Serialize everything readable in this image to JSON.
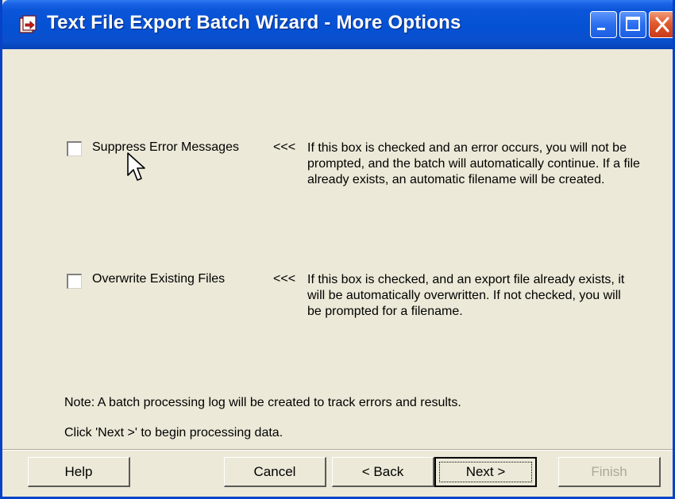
{
  "window": {
    "title": "Text File Export Batch Wizard - More Options"
  },
  "options": [
    {
      "label": "Suppress Error Messages",
      "checked": false,
      "arrows": "<<<",
      "description": "If this box is checked and an error occurs, you will not be prompted, and the batch will automatically continue. If a file already exists, an automatic filename will be created."
    },
    {
      "label": "Overwrite Existing Files",
      "checked": false,
      "arrows": "<<<",
      "description": "If this box is checked, and an export file already exists, it will be automatically overwritten. If not checked, you will be prompted for a filename."
    }
  ],
  "notes": {
    "log": "Note: A batch processing log will be created to track errors and results.",
    "next": "Click 'Next >' to begin processing data."
  },
  "buttons": {
    "help": "Help",
    "cancel": "Cancel",
    "back": "< Back",
    "next": "Next >",
    "finish": "Finish"
  },
  "icons": {
    "app": "export-wizard-icon",
    "minimize": "minimize-icon",
    "maximize": "maximize-icon",
    "close": "close-icon",
    "cursor": "mouse-pointer-icon"
  },
  "colors": {
    "titlebar": "#0551d4",
    "window_bg": "#ece9d8",
    "close_button": "#e15a2e",
    "disabled_text": "#aca899"
  }
}
